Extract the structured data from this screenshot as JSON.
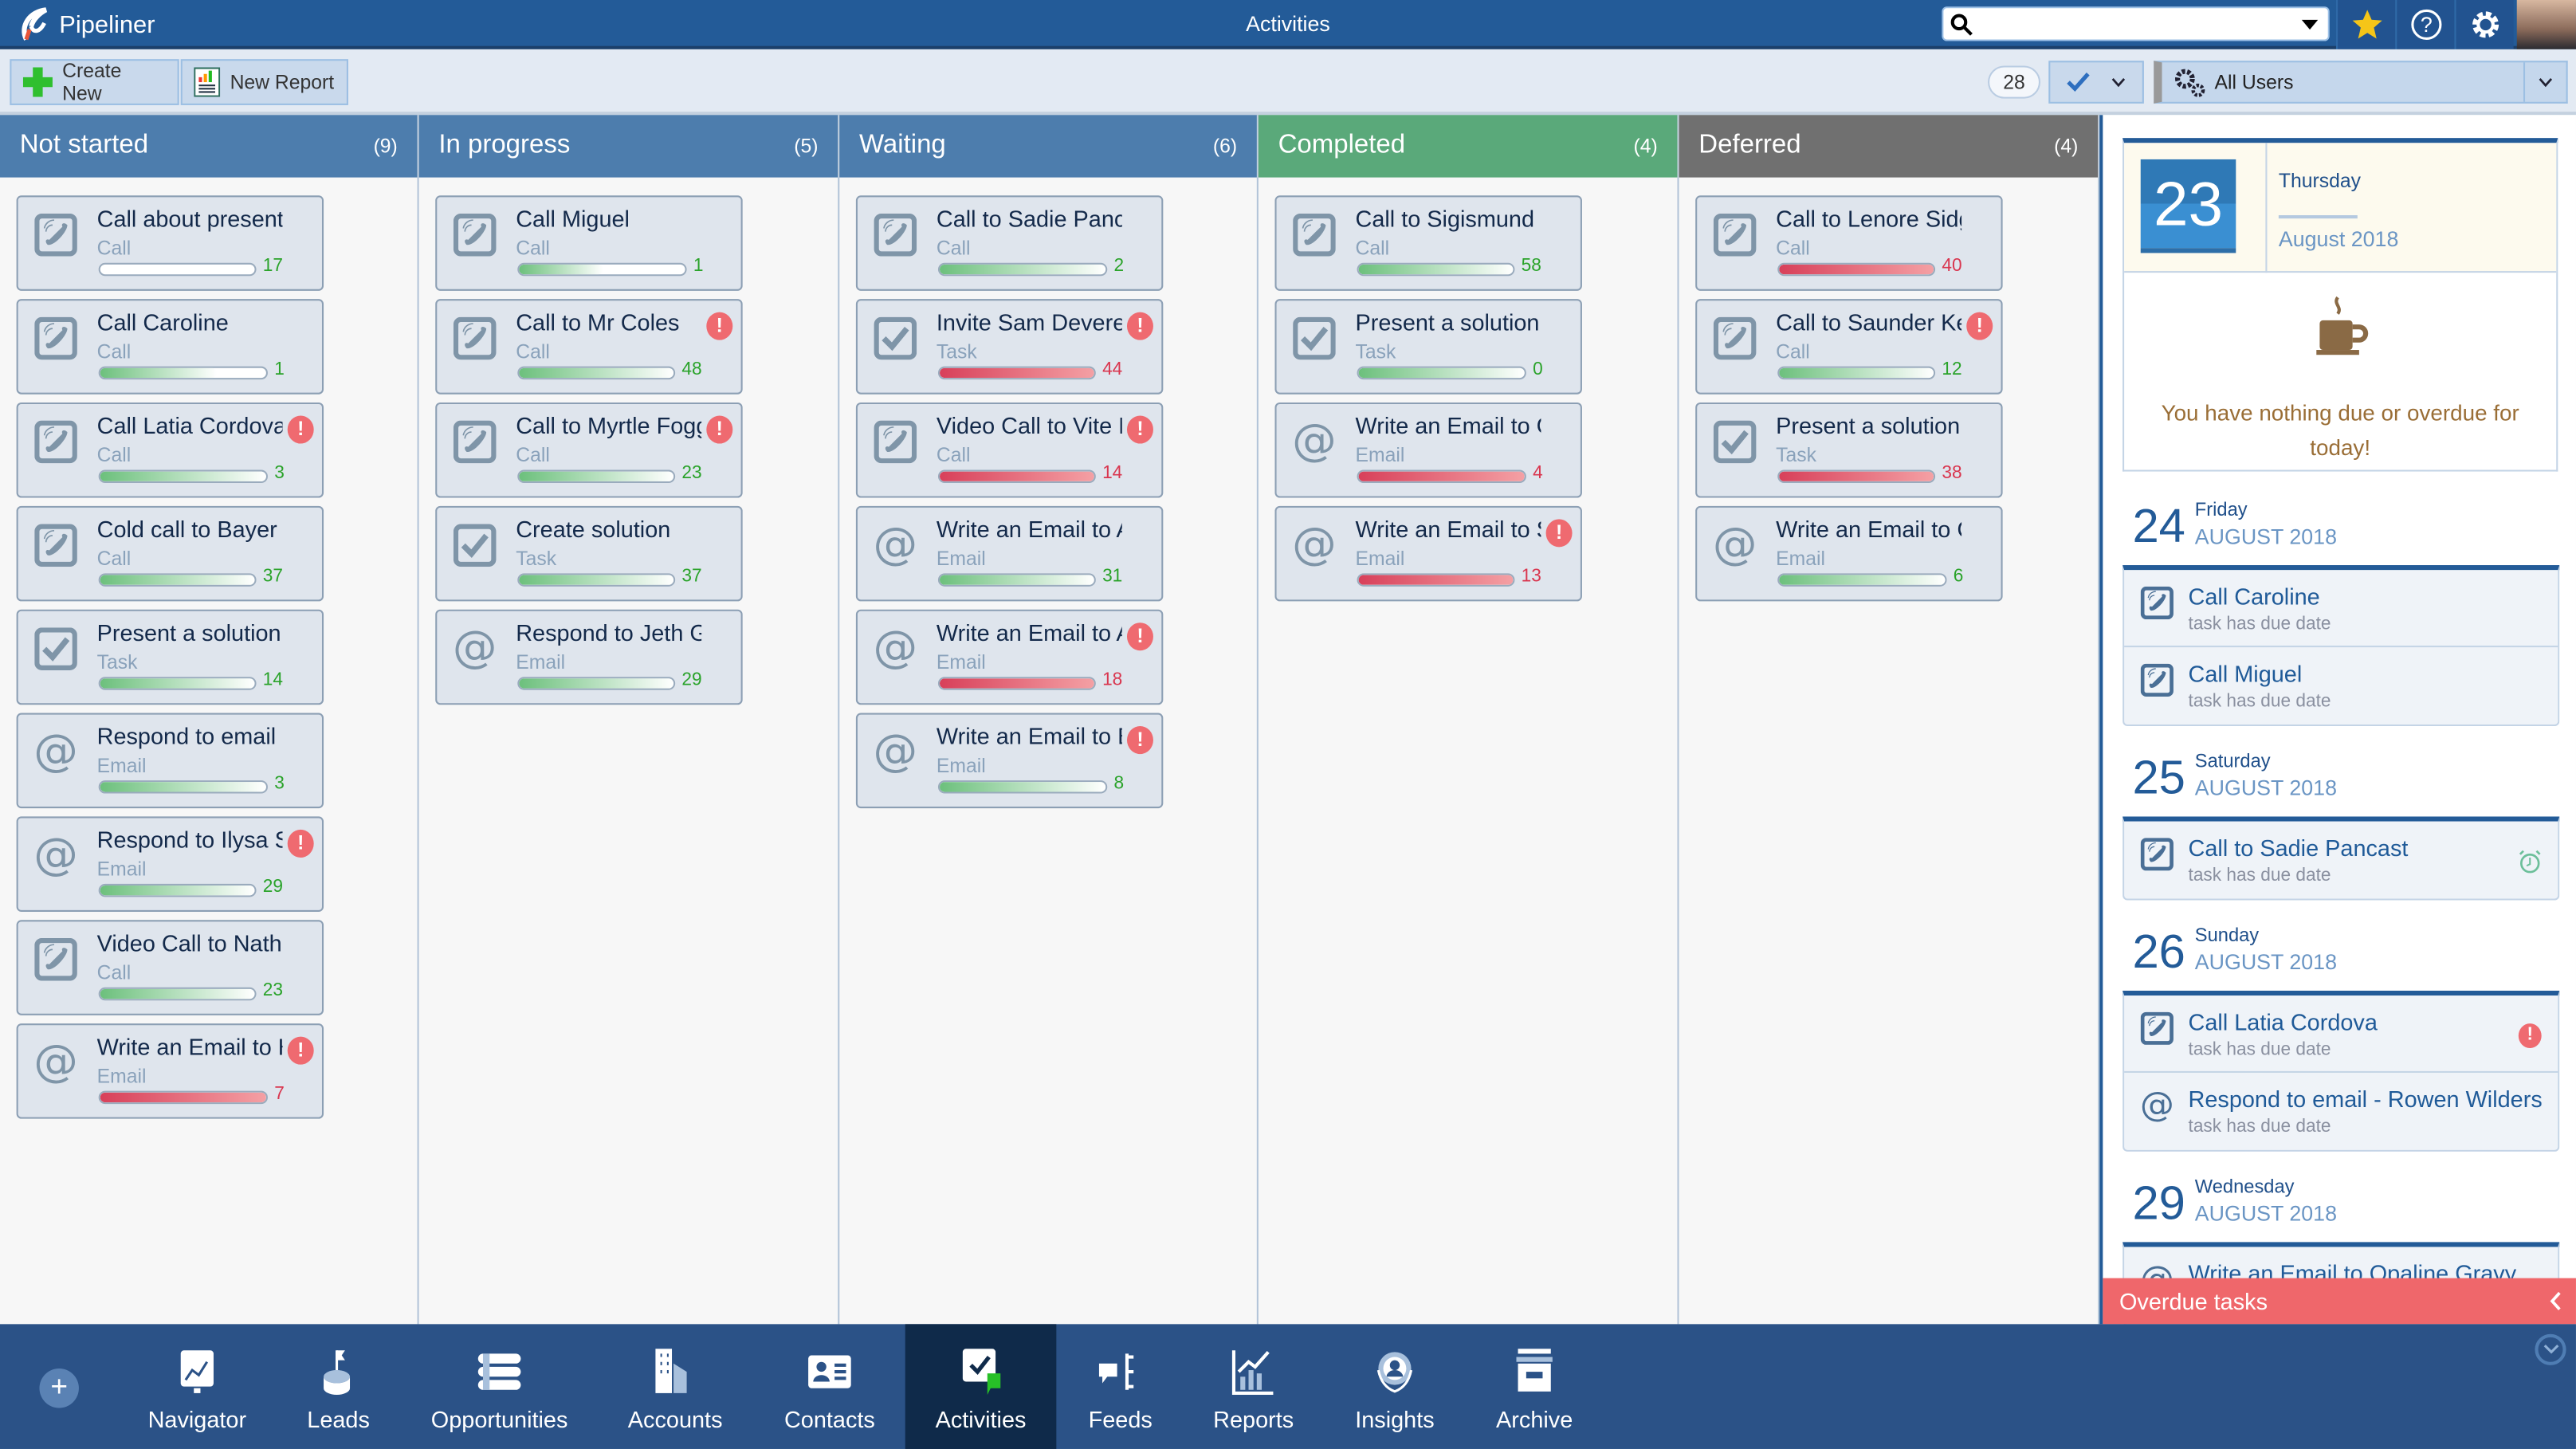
{
  "app": {
    "name": "Pipeliner",
    "title": "Activities"
  },
  "header": {
    "search_value": "",
    "icons": [
      "search-icon",
      "dropdown-icon",
      "star-icon",
      "help-icon",
      "gear-icon",
      "avatar"
    ]
  },
  "toolbar": {
    "create_new": "Create New",
    "new_report": "New Report",
    "count": "28",
    "users_filter": "All Users"
  },
  "colors": {
    "primary": "#235b98",
    "ok": "#2aa32a",
    "overdue": "#d9364f",
    "completed_header": "#5aa97a",
    "deferred_header": "#707070",
    "overdue_bar": "#ef676b"
  },
  "columns": [
    {
      "title": "Not started",
      "count": "(9)",
      "color": "#4d7dad",
      "cards": [
        {
          "title": "Call about presentation",
          "type": "Call",
          "icon": "phone",
          "value": "17",
          "status": "ok",
          "fill": 0,
          "alert": false
        },
        {
          "title": "Call Caroline",
          "type": "Call",
          "icon": "phone",
          "value": "1",
          "status": "ok",
          "fill": 0.7,
          "alert": false
        },
        {
          "title": "Call Latia Cordova",
          "type": "Call",
          "icon": "phone",
          "value": "3",
          "status": "ok",
          "fill": 1,
          "alert": true
        },
        {
          "title": "Cold call to Bayer",
          "type": "Call",
          "icon": "phone",
          "value": "37",
          "status": "ok",
          "fill": 1,
          "alert": false
        },
        {
          "title": "Present a solution",
          "type": "Task",
          "icon": "task",
          "value": "14",
          "status": "ok",
          "fill": 1,
          "alert": false
        },
        {
          "title": "Respond to email - ",
          "type": "Email",
          "icon": "email",
          "value": "3",
          "status": "ok",
          "fill": 1,
          "alert": false
        },
        {
          "title": "Respond to Ilysa S",
          "type": "Email",
          "icon": "email",
          "value": "29",
          "status": "ok",
          "fill": 1,
          "alert": true
        },
        {
          "title": "Video Call to Nathan",
          "type": "Call",
          "icon": "phone",
          "value": "23",
          "status": "ok",
          "fill": 1,
          "alert": false
        },
        {
          "title": "Write an Email to H",
          "type": "Email",
          "icon": "email",
          "value": "7",
          "status": "overdue",
          "fill": 1,
          "alert": true
        }
      ]
    },
    {
      "title": "In progress",
      "count": "(5)",
      "color": "#4d7dad",
      "cards": [
        {
          "title": "Call Miguel",
          "type": "Call",
          "icon": "phone",
          "value": "1",
          "status": "ok",
          "fill": 0.5,
          "alert": false
        },
        {
          "title": "Call to Mr Coles",
          "type": "Call",
          "icon": "phone",
          "value": "48",
          "status": "ok",
          "fill": 1,
          "alert": true
        },
        {
          "title": "Call to Myrtle Fogg",
          "type": "Call",
          "icon": "phone",
          "value": "23",
          "status": "ok",
          "fill": 1,
          "alert": true
        },
        {
          "title": "Create solution",
          "type": "Task",
          "icon": "task",
          "value": "37",
          "status": "ok",
          "fill": 1,
          "alert": false
        },
        {
          "title": "Respond to Jeth G",
          "type": "Email",
          "icon": "email",
          "value": "29",
          "status": "ok",
          "fill": 1,
          "alert": false
        }
      ]
    },
    {
      "title": "Waiting",
      "count": "(6)",
      "color": "#4d7dad",
      "cards": [
        {
          "title": "Call to Sadie Pancast",
          "type": "Call",
          "icon": "phone",
          "value": "2",
          "status": "ok",
          "fill": 1,
          "alert": false
        },
        {
          "title": "Invite Sam Deverell",
          "type": "Task",
          "icon": "task",
          "value": "44",
          "status": "overdue",
          "fill": 1,
          "alert": true
        },
        {
          "title": "Video Call to Vite M",
          "type": "Call",
          "icon": "phone",
          "value": "14",
          "status": "overdue",
          "fill": 1,
          "alert": true
        },
        {
          "title": "Write an Email to A",
          "type": "Email",
          "icon": "email",
          "value": "31",
          "status": "ok",
          "fill": 1,
          "alert": false
        },
        {
          "title": "Write an Email to A",
          "type": "Email",
          "icon": "email",
          "value": "18",
          "status": "overdue",
          "fill": 1,
          "alert": true
        },
        {
          "title": "Write an Email to B",
          "type": "Email",
          "icon": "email",
          "value": "8",
          "status": "ok",
          "fill": 1,
          "alert": true
        }
      ]
    },
    {
      "title": "Completed",
      "count": "(4)",
      "color": "#5aa97a",
      "cards": [
        {
          "title": "Call to Sigismund J",
          "type": "Call",
          "icon": "phone",
          "value": "58",
          "status": "ok",
          "fill": 1,
          "alert": false
        },
        {
          "title": "Present a solution",
          "type": "Task",
          "icon": "task",
          "value": "0",
          "status": "ok",
          "fill": 1,
          "alert": false
        },
        {
          "title": "Write an Email to G",
          "type": "Email",
          "icon": "email",
          "value": "4",
          "status": "overdue",
          "fill": 1,
          "alert": false
        },
        {
          "title": "Write an Email to S",
          "type": "Email",
          "icon": "email",
          "value": "13",
          "status": "overdue",
          "fill": 1,
          "alert": true
        }
      ]
    },
    {
      "title": "Deferred",
      "count": "(4)",
      "color": "#707070",
      "cards": [
        {
          "title": "Call to Lenore Sidg",
          "type": "Call",
          "icon": "phone",
          "value": "40",
          "status": "overdue",
          "fill": 1,
          "alert": false
        },
        {
          "title": "Call to Saunder Kei",
          "type": "Call",
          "icon": "phone",
          "value": "12",
          "status": "ok",
          "fill": 1,
          "alert": true
        },
        {
          "title": "Present a solution",
          "type": "Task",
          "icon": "task",
          "value": "38",
          "status": "overdue",
          "fill": 1,
          "alert": false
        },
        {
          "title": "Write an Email to C",
          "type": "Email",
          "icon": "email",
          "value": "6",
          "status": "ok",
          "fill": 1,
          "alert": false
        }
      ]
    }
  ],
  "agenda": {
    "today": {
      "day": "23",
      "weekday": "Thursday",
      "month": "August 2018",
      "message": "You have nothing due or overdue for today!"
    },
    "days": [
      {
        "day": "24",
        "weekday": "Friday",
        "month": "AUGUST 2018",
        "items": [
          {
            "title": "Call Caroline",
            "sub": "task has due date",
            "icon": "phone",
            "flag": ""
          },
          {
            "title": "Call Miguel",
            "sub": "task has due date",
            "icon": "phone",
            "flag": ""
          }
        ]
      },
      {
        "day": "25",
        "weekday": "Saturday",
        "month": "AUGUST 2018",
        "items": [
          {
            "title": "Call to Sadie Pancast",
            "sub": "task has due date",
            "icon": "phone",
            "flag": "alarm"
          }
        ]
      },
      {
        "day": "26",
        "weekday": "Sunday",
        "month": "AUGUST 2018",
        "items": [
          {
            "title": "Call Latia Cordova",
            "sub": "task has due date",
            "icon": "phone",
            "flag": "alert"
          },
          {
            "title": "Respond to email - Rowen Wilders...",
            "sub": "task has due date",
            "icon": "email",
            "flag": ""
          }
        ]
      },
      {
        "day": "29",
        "weekday": "Wednesday",
        "month": "AUGUST 2018",
        "items": [
          {
            "title": "Write an Email to Opaline Gravy",
            "sub": "",
            "icon": "email",
            "flag": ""
          }
        ]
      }
    ],
    "overdue_label": "Overdue tasks"
  },
  "nav": {
    "active": "Activities",
    "items": [
      "Navigator",
      "Leads",
      "Opportunities",
      "Accounts",
      "Contacts",
      "Activities",
      "Feeds",
      "Reports",
      "Insights",
      "Archive"
    ]
  }
}
